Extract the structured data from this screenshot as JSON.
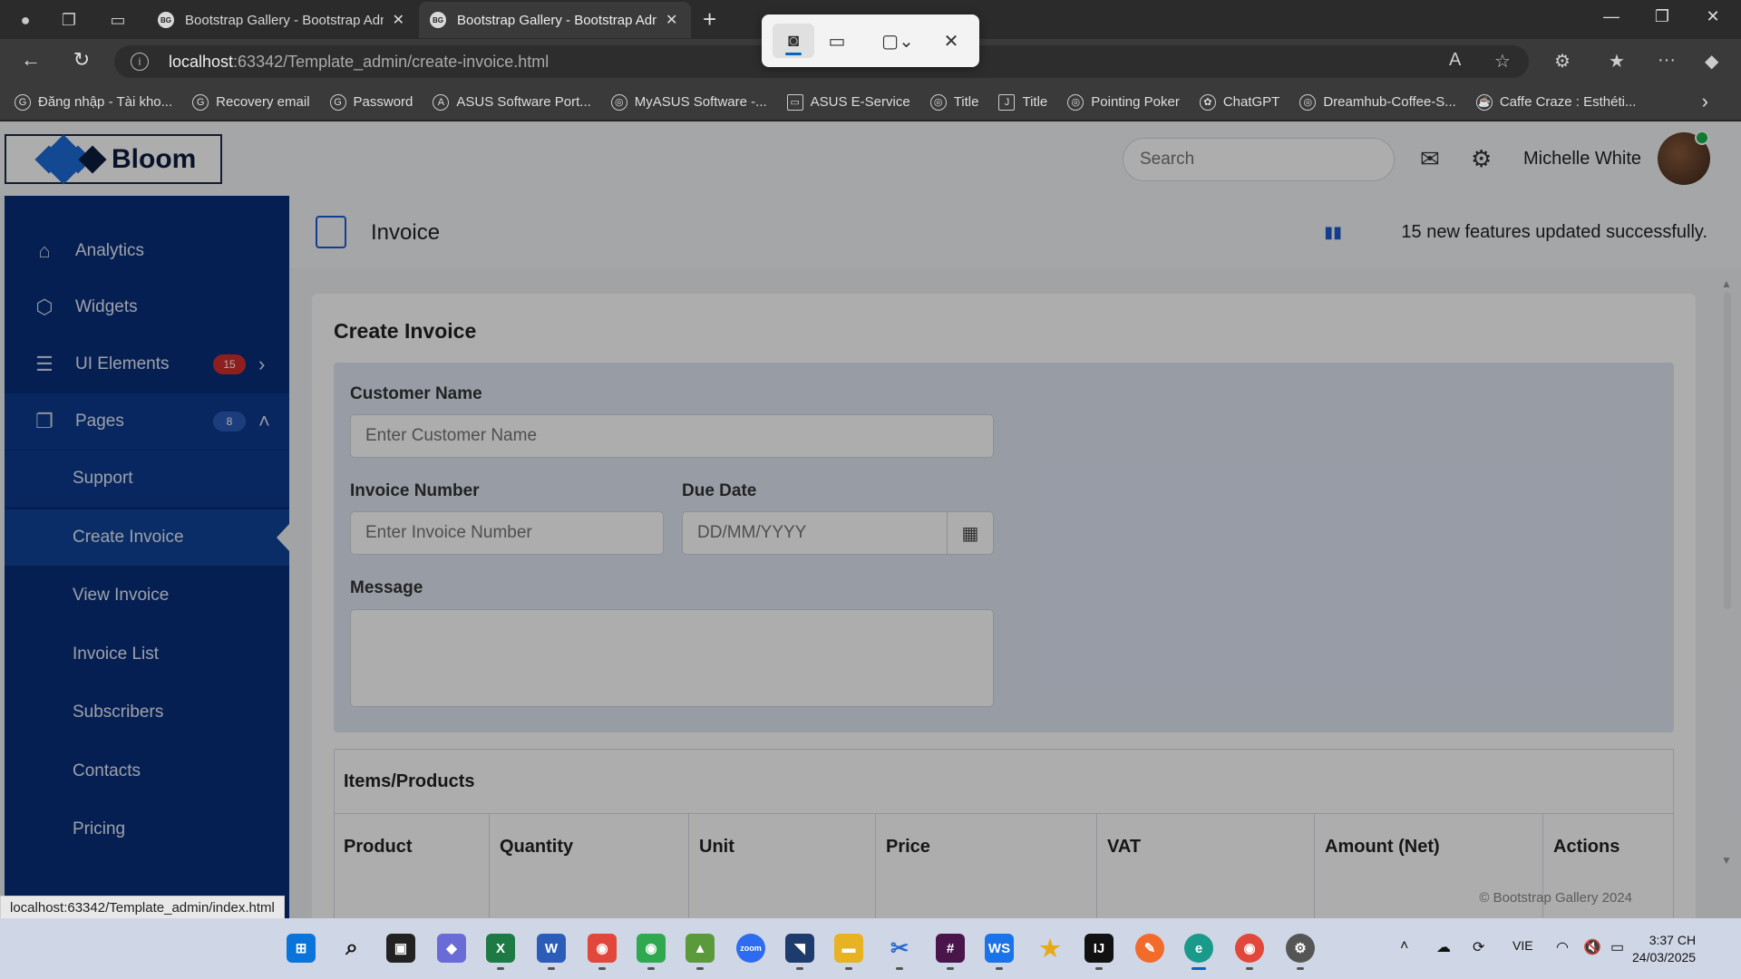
{
  "browser": {
    "tabs": [
      {
        "title": "Bootstrap Gallery - Bootstrap Admin Templates",
        "favicon": "BG",
        "active": false
      },
      {
        "title": "Bootstrap Gallery - Bootstrap Admin Templates",
        "favicon": "BG",
        "active": true
      }
    ],
    "url_host": "localhost",
    "url_path": ":63342/Template_admin/create-invoice.html",
    "bookmarks": [
      {
        "label": "Đăng nhập - Tài kho...",
        "icon": "google-icon"
      },
      {
        "label": "Recovery email",
        "icon": "google-icon"
      },
      {
        "label": "Password",
        "icon": "google-icon"
      },
      {
        "label": "ASUS Software Port...",
        "icon": "asus-icon"
      },
      {
        "label": "MyASUS Software -...",
        "icon": "globe-icon"
      },
      {
        "label": "ASUS E-Service",
        "icon": "folder-icon"
      },
      {
        "label": "Title",
        "icon": "globe-icon"
      },
      {
        "label": "Title",
        "icon": "jetbrains-icon"
      },
      {
        "label": "Pointing Poker",
        "icon": "globe-icon"
      },
      {
        "label": "ChatGPT",
        "icon": "chatgpt-icon"
      },
      {
        "label": "Dreamhub-Coffee-S...",
        "icon": "globe-icon"
      },
      {
        "label": "Caffe Craze : Esthéti...",
        "icon": "coffee-icon"
      }
    ],
    "status_url": "localhost:63342/Template_admin/index.html"
  },
  "header": {
    "logo_text": "Bloom",
    "search_placeholder": "Search",
    "user_name": "Michelle White"
  },
  "sidebar": {
    "items": [
      {
        "label": "Analytics",
        "icon": "home-icon"
      },
      {
        "label": "Widgets",
        "icon": "box-icon"
      },
      {
        "label": "UI Elements",
        "icon": "layers-icon",
        "badge": "15"
      },
      {
        "label": "Pages",
        "icon": "pages-icon",
        "badge": "8"
      },
      {
        "label": "Support"
      },
      {
        "label": "Create Invoice"
      },
      {
        "label": "View Invoice"
      },
      {
        "label": "Invoice List"
      },
      {
        "label": "Subscribers"
      },
      {
        "label": "Contacts"
      },
      {
        "label": "Pricing"
      }
    ]
  },
  "content": {
    "page_title": "Invoice",
    "notice": "15 new features updated successfully.",
    "card_title": "Create Invoice",
    "form": {
      "customer_label": "Customer Name",
      "customer_placeholder": "Enter Customer Name",
      "invoice_label": "Invoice Number",
      "invoice_placeholder": "Enter Invoice Number",
      "due_label": "Due Date",
      "due_placeholder": "DD/MM/YYYY",
      "message_label": "Message"
    },
    "items_title": "Items/Products",
    "columns": [
      "Product",
      "Quantity",
      "Unit",
      "Price",
      "VAT",
      "Amount (Net)",
      "Actions"
    ],
    "footer": "© Bootstrap Gallery 2024"
  },
  "taskbar": {
    "language": "VIE",
    "time": "3:37 CH",
    "date": "24/03/2025"
  },
  "colors": {
    "sidebar": "#0a2f7a",
    "accent": "#1f5bd0",
    "badge_red": "#d32f2f"
  }
}
